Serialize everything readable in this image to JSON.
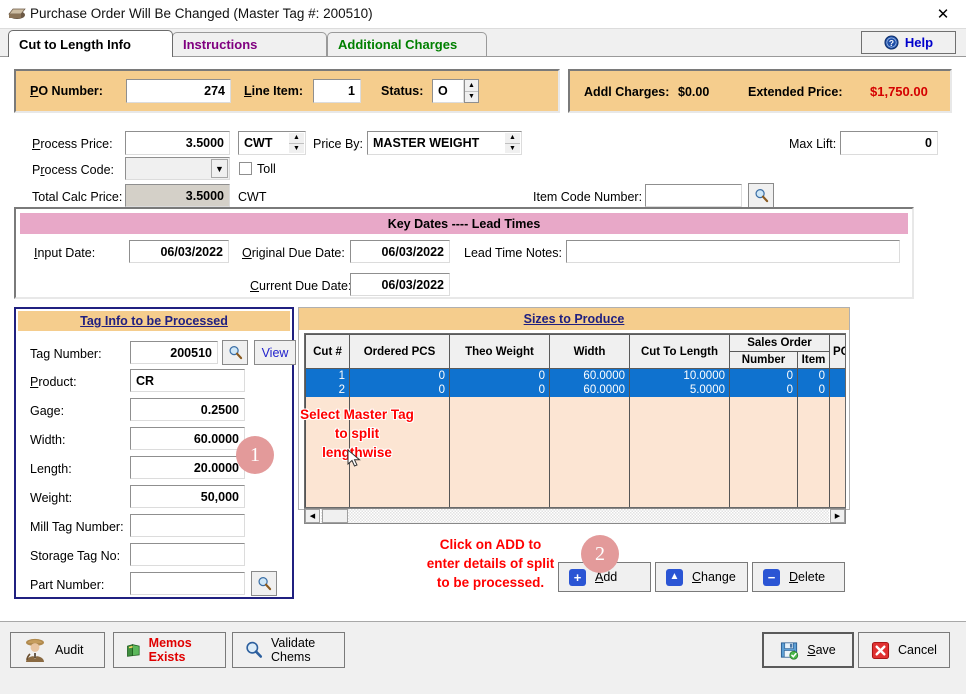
{
  "window": {
    "title": "Purchase Order Will Be Changed  (Master Tag #: 200510)",
    "close_label": "✕",
    "icon": "window-app-icon"
  },
  "tabs": [
    {
      "label": "Cut to Length Info",
      "active": true
    },
    {
      "label": "Instructions",
      "active": false
    },
    {
      "label": "Additional Charges",
      "active": false
    }
  ],
  "help": {
    "label": "Help",
    "icon": "help-question-icon"
  },
  "po_panel": {
    "po_number_label": "PO Number:",
    "po_number_value": "274",
    "line_item_label": "Line Item:",
    "line_item_value": "1",
    "status_label": "Status:",
    "status_value": "O"
  },
  "price_panel": {
    "addl_charges_label": "Addl Charges:",
    "addl_charges_value": "$0.00",
    "extended_price_label": "Extended Price:",
    "extended_price_value": "$1,750.00",
    "extended_price_color": "#d40000"
  },
  "pricing": {
    "process_price_label": "Process Price:",
    "process_price_value": "3.5000",
    "process_price_uom": "CWT",
    "price_by_label": "Price By:",
    "price_by_value": "MASTER WEIGHT",
    "process_code_label": "Process Code:",
    "process_code_value": "",
    "toll_label": "Toll",
    "toll_checked": false,
    "total_calc_price_label": "Total Calc Price:",
    "total_calc_price_value": "3.5000",
    "total_calc_price_uom": "CWT",
    "max_lift_label": "Max Lift:",
    "max_lift_value": "0",
    "item_code_label": "Item Code Number:",
    "item_code_value": "",
    "item_code_search_icon": "magnifier-icon"
  },
  "key_dates": {
    "title": "Key Dates ---- Lead Times",
    "input_date_label": "Input Date:",
    "input_date_value": "06/03/2022",
    "original_due_date_label": "Original Due Date:",
    "original_due_date_value": "06/03/2022",
    "current_due_date_label": "Current Due Date:",
    "current_due_date_value": "06/03/2022",
    "lead_time_notes_label": "Lead Time Notes:",
    "lead_time_notes_value": ""
  },
  "tag_info": {
    "title": "Tag Info to be Processed",
    "search_icon": "magnifier-icon",
    "view_label": "View",
    "fields": [
      {
        "label": "Tag Number:",
        "value": "200510"
      },
      {
        "label": "Product:",
        "value": "CR"
      },
      {
        "label": "Gage:",
        "value": "0.2500"
      },
      {
        "label": "Width:",
        "value": "60.0000"
      },
      {
        "label": "Length:",
        "value": "20.0000"
      },
      {
        "label": "Weight:",
        "value": "50,000"
      },
      {
        "label": "Mill Tag Number:",
        "value": ""
      },
      {
        "label": "Storage Tag No:",
        "value": ""
      },
      {
        "label": "Part Number:",
        "value": ""
      }
    ]
  },
  "sizes": {
    "title": "Sizes to Produce",
    "columns": [
      "Cut #",
      "Ordered PCS",
      "Theo Weight",
      "Width",
      "Cut To Length",
      "Sales Order",
      "PO"
    ],
    "sales_order_subcolumns": [
      "Number",
      "Item"
    ],
    "rows": [
      {
        "cut": "1",
        "ordered_pcs": "0",
        "theo_weight": "0",
        "width": "60.0000",
        "cut_to_length": "10.0000",
        "so_number": "0",
        "so_item": "0",
        "po": "",
        "selected": true
      },
      {
        "cut": "2",
        "ordered_pcs": "0",
        "theo_weight": "0",
        "width": "60.0000",
        "cut_to_length": "5.0000",
        "so_number": "0",
        "so_item": "0",
        "po": "",
        "selected": true
      }
    ]
  },
  "grid_actions": [
    {
      "label": "Add",
      "icon": "plus-icon",
      "glyph": "+"
    },
    {
      "label": "Change",
      "icon": "triangle-up-icon",
      "glyph": "▲"
    },
    {
      "label": "Delete",
      "icon": "minus-icon",
      "glyph": "−"
    }
  ],
  "bottom_bar": {
    "audit_label": "Audit",
    "audit_icon": "detective-person-icon",
    "memos_label": "Memos Exists",
    "memos_icon": "green-book-icon",
    "memos_color": "#e00000",
    "validate_label_line1": "Validate",
    "validate_label_line2": "Chems",
    "validate_icon": "magnifier-icon",
    "save_label": "Save",
    "save_icon": "floppy-save-icon",
    "cancel_label": "Cancel",
    "cancel_icon": "red-x-icon"
  },
  "annotations": {
    "badge_one": "1",
    "badge_two": "2",
    "note_one_line1": "Select Master Tag",
    "note_one_line2": "to split",
    "note_one_line3": "lengthwise",
    "note_two_line1": "Click on ADD to",
    "note_two_line2": "enter details of split",
    "note_two_line3": "to be processed.",
    "color": "#ff0000"
  }
}
